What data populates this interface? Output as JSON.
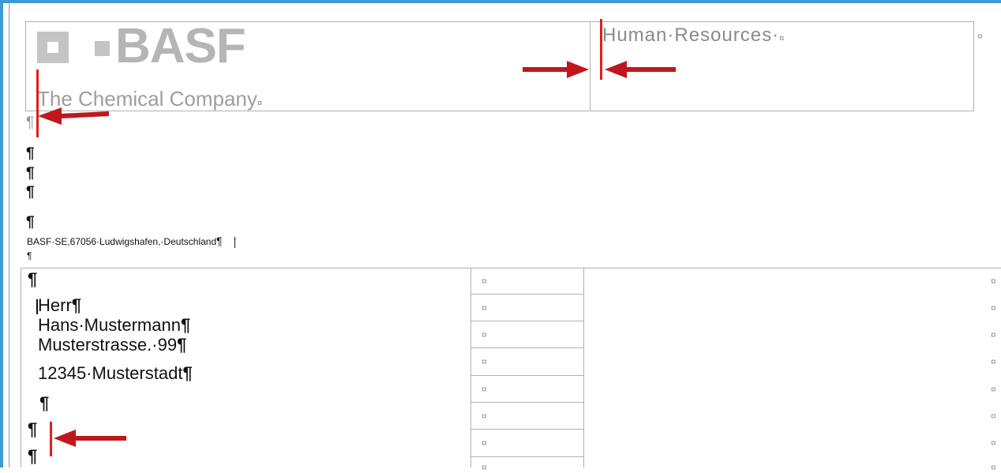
{
  "header": {
    "logo_word": "BASF",
    "tagline": "The Chemical Company",
    "department": "Human·Resources·",
    "cell_end_mark": "¤"
  },
  "pilcrow": "¶",
  "sender_line": "BASF·SE,67056·Ludwigshafen,·Deutschland",
  "address": {
    "lines": [
      "Herr",
      "Hans·Mustermann",
      "Musterstrasse.·99",
      "12345·Musterstadt"
    ]
  },
  "colors": {
    "arrow": "#c0171d",
    "cursor": "#e01e1e",
    "frame": "#3d9bd3"
  },
  "icons": [
    "arrow-right-icon",
    "arrow-left-icon",
    "text-cursor-icon"
  ]
}
